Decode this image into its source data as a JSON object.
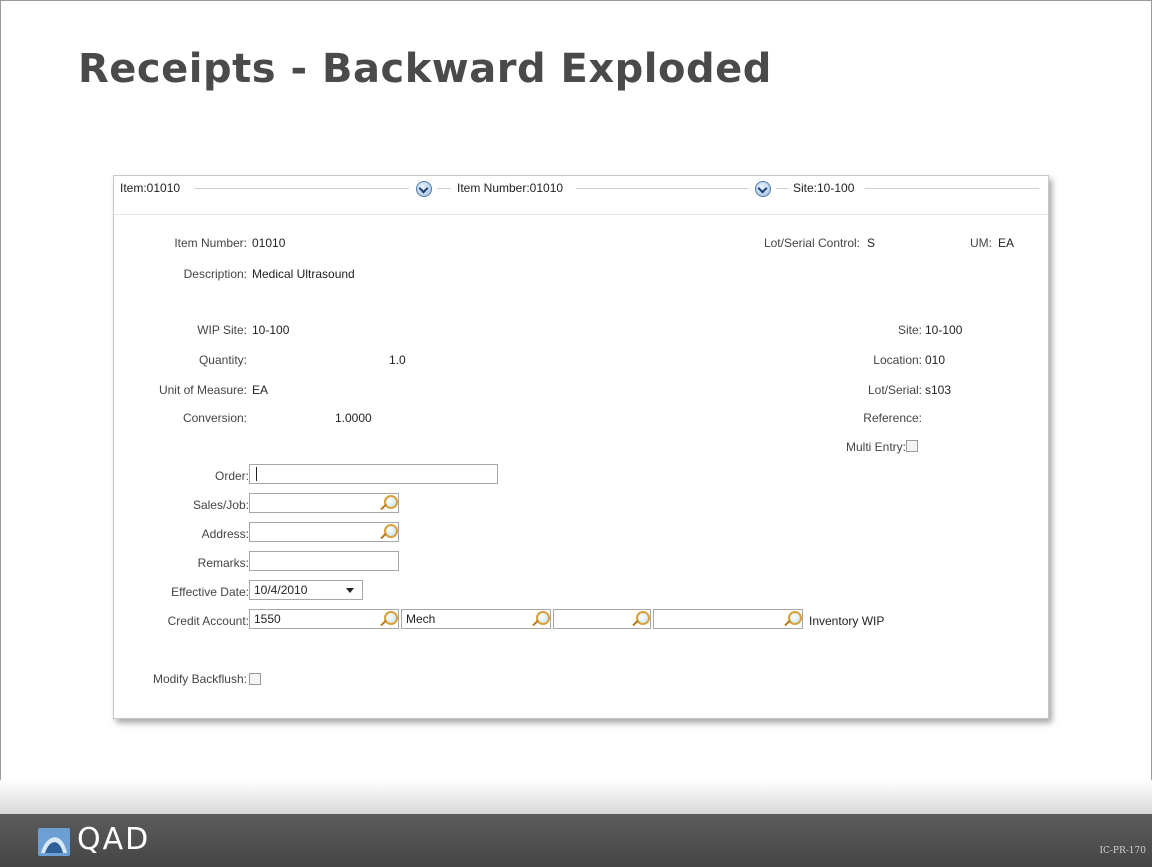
{
  "slide": {
    "title": "Receipts - Backward Exploded",
    "code": "IC-PR-170"
  },
  "header": {
    "item": "Item:01010",
    "item_number": "Item Number:01010",
    "site": "Site:10-100"
  },
  "info": {
    "item_number_label": "Item Number:",
    "item_number_value": "01010",
    "lot_serial_control_label": "Lot/Serial Control:",
    "lot_serial_control_value": "S",
    "um_label": "UM:",
    "um_value": "EA",
    "description_label": "Description:",
    "description_value": "Medical Ultrasound",
    "wip_site_label": "WIP Site:",
    "wip_site_value": "10-100",
    "site_label": "Site:",
    "site_value": "10-100",
    "quantity_label": "Quantity:",
    "quantity_value": "1.0",
    "location_label": "Location:",
    "location_value": "010",
    "unit_of_measure_label": "Unit of Measure:",
    "unit_of_measure_value": "EA",
    "lot_serial_label": "Lot/Serial:",
    "lot_serial_value": "s103",
    "conversion_label": "Conversion:",
    "conversion_value": "1.0000",
    "reference_label": "Reference:",
    "multi_entry_label": "Multi Entry:",
    "multi_entry_checked": false
  },
  "form": {
    "order_label": "Order:",
    "order_value": "",
    "sales_job_label": "Sales/Job:",
    "sales_job_value": "",
    "address_label": "Address:",
    "address_value": "",
    "remarks_label": "Remarks:",
    "remarks_value": "",
    "effective_date_label": "Effective Date:",
    "effective_date_value": "10/4/2010",
    "credit_account_label": "Credit Account:",
    "credit_account_value": "1550",
    "sub_account_value": "Mech",
    "cost_center_value": "",
    "project_value": "",
    "account_description": "Inventory WIP",
    "modify_backflush_label": "Modify Backflush:",
    "modify_backflush_checked": false
  },
  "footer": {
    "logo_text": "QAD"
  },
  "colors": {
    "title": "#4a4a4a",
    "footer": "#4f4f4f",
    "dropdown_icon": "#4f78aa",
    "lookup_icon": "#d8a238"
  }
}
